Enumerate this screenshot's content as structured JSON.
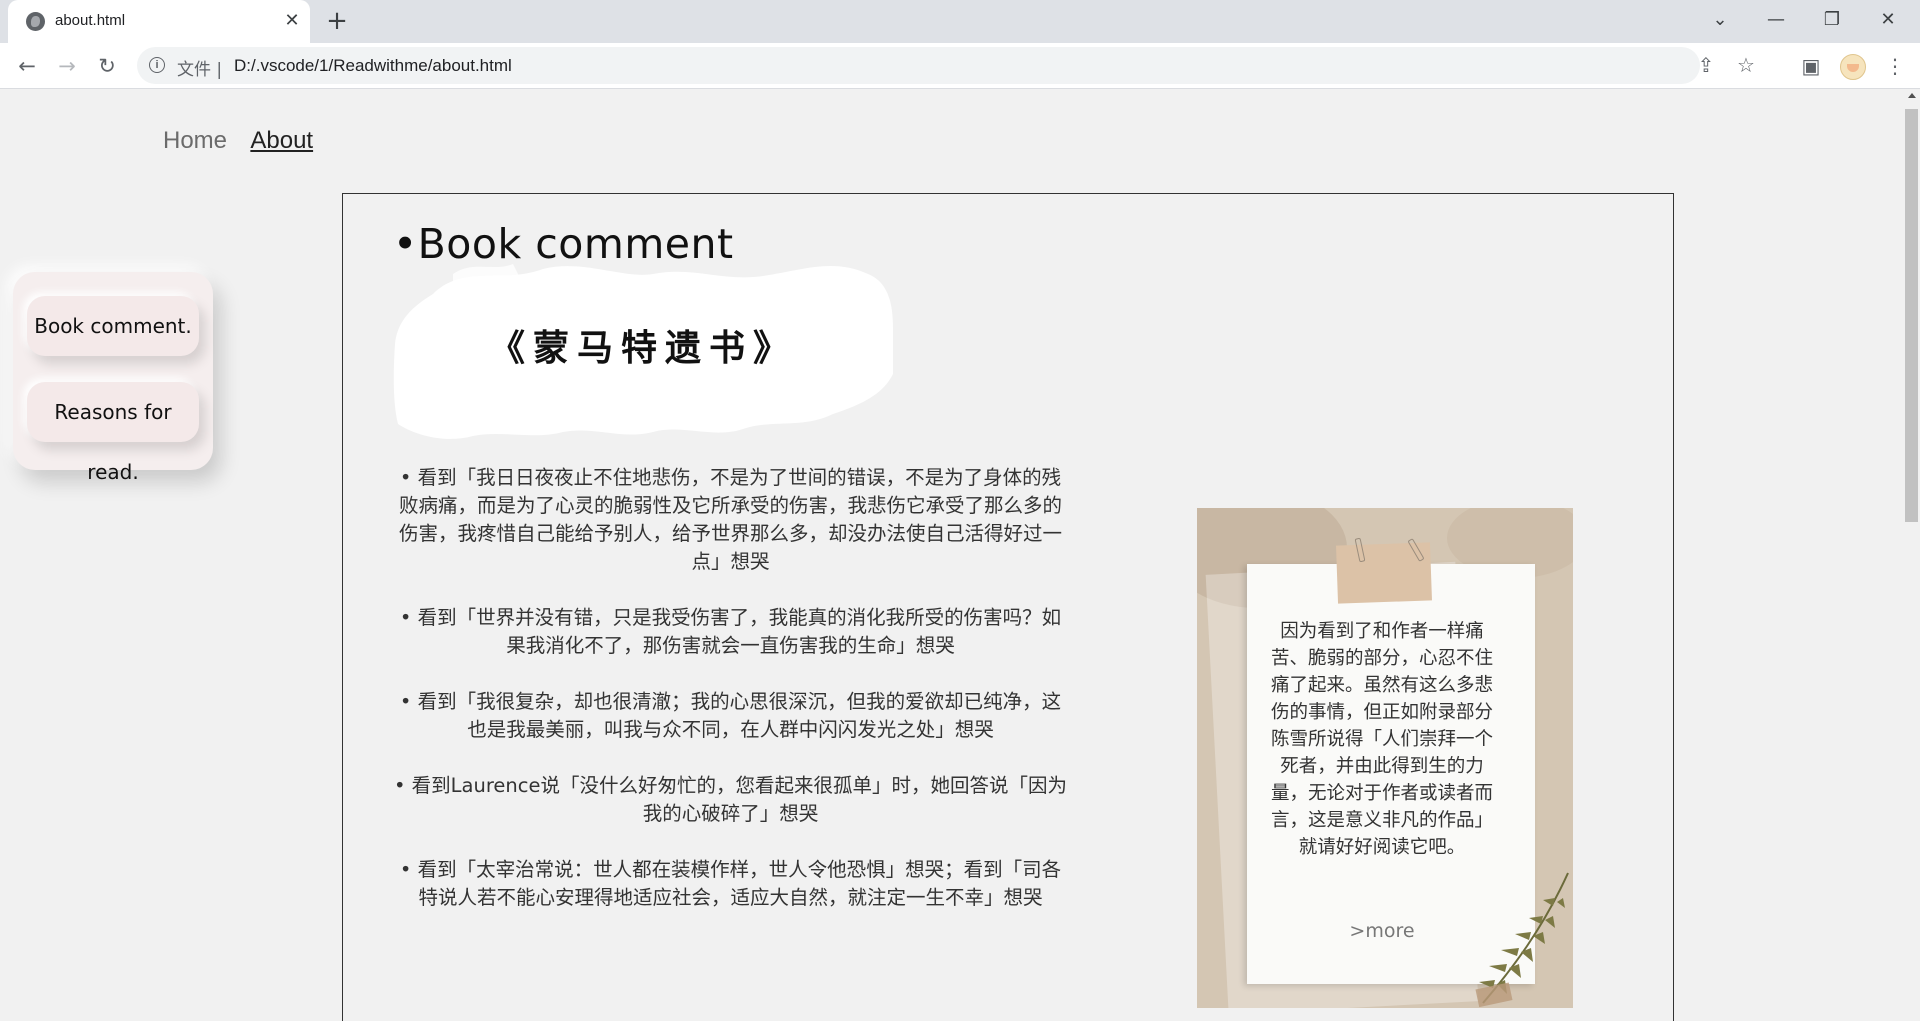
{
  "browser": {
    "tab_title": "about.html",
    "tab_close": "✕",
    "new_tab": "+",
    "scheme_label": "文件 |",
    "url": "D:/.vscode/1/Readwithme/about.html"
  },
  "nav": {
    "home": "Home",
    "about": "About"
  },
  "side_menu": {
    "items": [
      {
        "label": "Book comment."
      },
      {
        "label": "Reasons for read."
      }
    ]
  },
  "main": {
    "section_title": "•Book comment",
    "book_title": "《蒙马特遗书》",
    "quotes": [
      "• 看到「我日日夜夜止不住地悲伤，不是为了世间的错误，不是为了身体的残败病痛，而是为了心灵的脆弱性及它所承受的伤害，我悲伤它承受了那么多的伤害，我疼惜自己能给予别人，给予世界那么多，却没办法使自己活得好过一点」想哭",
      "• 看到「世界并没有错，只是我受伤害了，我能真的消化我所受的伤害吗？如果我消化不了，那伤害就会一直伤害我的生命」想哭",
      "• 看到「我很复杂，却也很清澈；我的心思很深沉，但我的爱欲却已纯净，这也是我最美丽，叫我与众不同，在人群中闪闪发光之处」想哭",
      "• 看到Laurence说「没什么好匆忙的，您看起来很孤单」时，她回答说「因为我的心破碎了」想哭",
      "• 看到「太宰治常说：世人都在装模作样，世人令他恐惧」想哭；看到「司各特说人若不能心安理得地适应社会，适应大自然，就注定一生不幸」想哭"
    ]
  },
  "note_card": {
    "text": "因为看到了和作者一样痛苦、脆弱的部分，心忍不住痛了起来。虽然有这么多悲伤的事情，但正如附录部分陈雪所说得「人们崇拜一个死者，并由此得到生的力量，无论对于作者或读者而言，这是意义非凡的作品」就请好好阅读它吧。",
    "more": ">more"
  }
}
